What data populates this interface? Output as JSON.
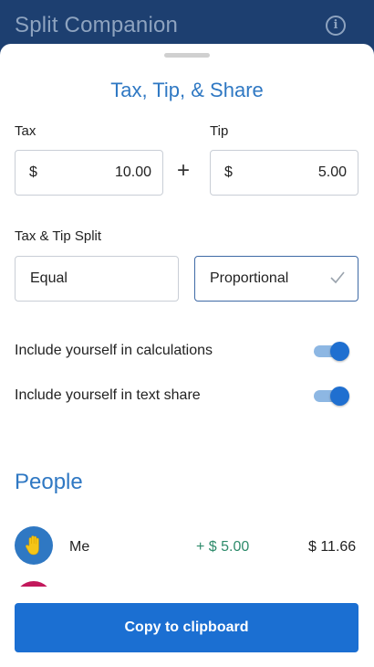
{
  "app": {
    "title": "Split Companion",
    "info_icon": "info-icon"
  },
  "sheet": {
    "title": "Tax, Tip, & Share"
  },
  "tax": {
    "label": "Tax",
    "currency": "$",
    "value": "10.00"
  },
  "tip": {
    "label": "Tip",
    "currency": "$",
    "value": "5.00"
  },
  "split": {
    "label": "Tax & Tip Split",
    "options": [
      {
        "label": "Equal",
        "selected": false
      },
      {
        "label": "Proportional",
        "selected": true
      }
    ]
  },
  "toggles": [
    {
      "label": "Include yourself in calculations",
      "on": true
    },
    {
      "label": "Include yourself in text share",
      "on": true
    }
  ],
  "people": {
    "title": "People",
    "items": [
      {
        "name": "Me",
        "tip_share": "+ $ 5.00",
        "total": "$ 11.66",
        "avatar_color": "#2f78c3",
        "avatar_icon": "raised-hand-icon"
      }
    ]
  },
  "actions": {
    "copy_label": "Copy to clipboard"
  },
  "colors": {
    "accent": "#2f78c3",
    "button": "#1b6fd2",
    "positive": "#2e8b6b",
    "app_bar": "#1d3f70"
  }
}
